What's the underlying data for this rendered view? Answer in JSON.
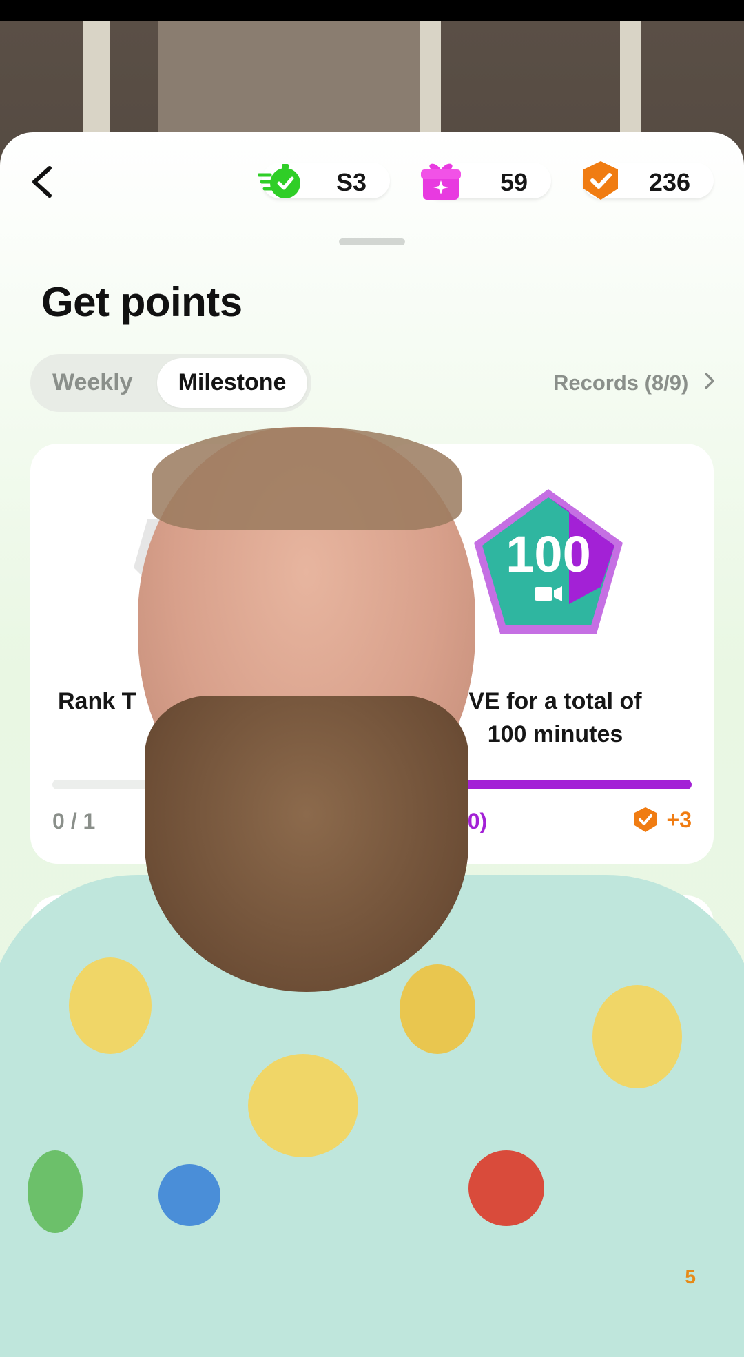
{
  "header": {
    "stats": [
      {
        "icon": "speed-stopwatch-icon",
        "value": "S3",
        "color": "#2fce27"
      },
      {
        "icon": "gift-box-icon",
        "value": "59",
        "color": "#e83ae0"
      },
      {
        "icon": "orange-check-shield-icon",
        "value": "236",
        "color": "#f07c12"
      }
    ]
  },
  "page": {
    "title": "Get points",
    "tabs": [
      {
        "label": "Weekly",
        "selected": false
      },
      {
        "label": "Milestone",
        "selected": true
      }
    ],
    "records_link": "Records (8/9)"
  },
  "cards": [
    {
      "title": "Rank T",
      "progress_text": "0 / 1",
      "progress": 0.0,
      "badge_icon": "rank-trophy-badge-icon"
    },
    {
      "title": "VE for a total of 100 minutes",
      "title_line1": "VE for a total of",
      "title_line2": "100 minutes",
      "badge_text": "100",
      "badge_icon": "live-100-badge-icon",
      "progress_text": "100 (20)",
      "progress": 1.0,
      "reward": "+3"
    }
  ],
  "overlay": {
    "corner_mark": "5"
  },
  "colors": {
    "accent_purple": "#a321d6",
    "reward_orange": "#f07c12"
  }
}
